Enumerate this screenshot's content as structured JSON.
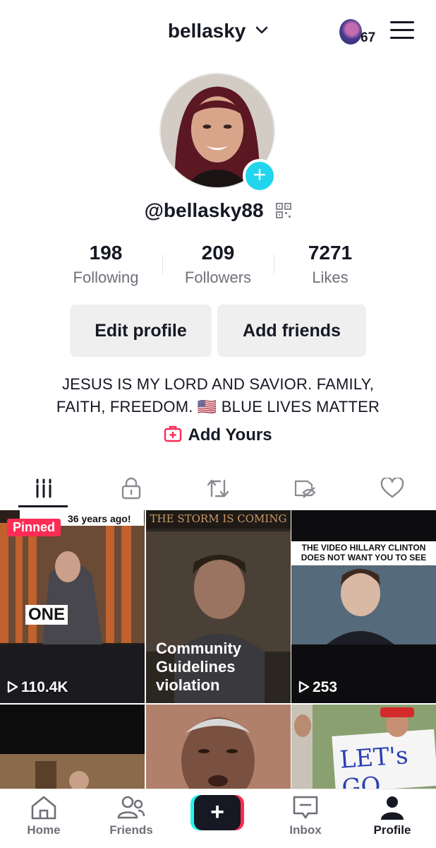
{
  "header": {
    "username": "bellasky",
    "notification_count": "67"
  },
  "profile": {
    "handle": "@bellasky88",
    "stats": [
      {
        "value": "198",
        "label": "Following"
      },
      {
        "value": "209",
        "label": "Followers"
      },
      {
        "value": "7271",
        "label": "Likes"
      }
    ],
    "buttons": {
      "edit": "Edit profile",
      "add_friends": "Add friends"
    },
    "bio_line1": "JESUS IS MY LORD AND SAVIOR. FAMILY,",
    "bio_line2": "FAITH, FREEDOM. 🇺🇸 BLUE LIVES MATTER",
    "add_yours": "Add Yours"
  },
  "tabs": [
    "videos-icon",
    "lock-icon",
    "repost-icon",
    "hidden-icon",
    "heart-icon"
  ],
  "videos": [
    {
      "pinned_label": "Pinned",
      "caption": "36 years ago!",
      "overlay": "ONE",
      "views": "110.4K"
    },
    {
      "caption": "THE STORM IS COMING",
      "overlay": "Community Guidelines violation",
      "line1": "Community",
      "line2": "Guidelines",
      "line3": "violation"
    },
    {
      "caption_line1": "THE VIDEO HILLARY CLINTON",
      "caption_line2": "DOES NOT WANT YOU TO SEE",
      "views": "253"
    },
    {},
    {},
    {
      "sign_text": "LET's GO"
    }
  ],
  "nav": {
    "home": "Home",
    "friends": "Friends",
    "create": "+",
    "inbox": "Inbox",
    "profile": "Profile"
  },
  "colors": {
    "accent_pink": "#fe2c55",
    "accent_cyan": "#20d5ec",
    "text": "#161823",
    "muted": "#6f7079"
  }
}
